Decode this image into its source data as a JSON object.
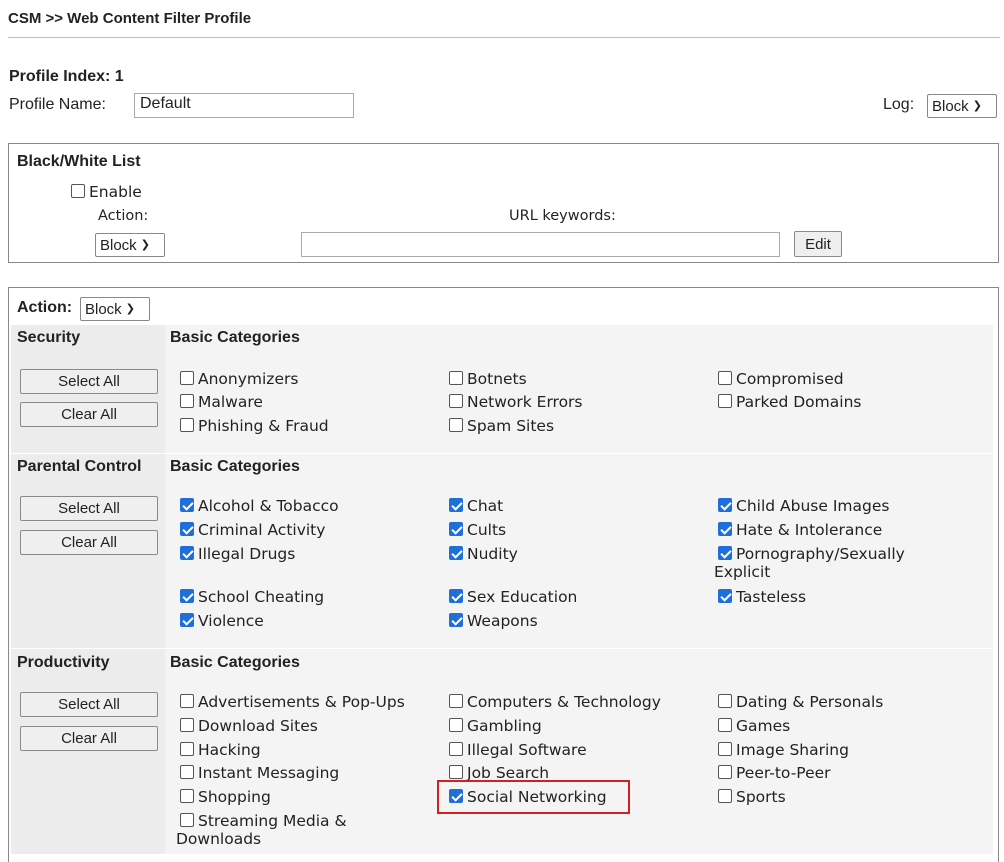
{
  "header": {
    "breadcrumb": "CSM >> Web Content Filter Profile"
  },
  "profile": {
    "index_label": "Profile Index: 1",
    "name_label": "Profile Name:",
    "name_value": "Default",
    "log_label": "Log:",
    "log_value": "Block"
  },
  "bw_list": {
    "title": "Black/White List",
    "enable_label": "Enable",
    "enable_checked": false,
    "action_label": "Action:",
    "action_value": "Block",
    "url_label": "URL keywords:",
    "url_value": "",
    "edit_label": "Edit"
  },
  "filter": {
    "action_label": "Action:",
    "action_value": "Block",
    "select_all_label": "Select All",
    "clear_all_label": "Clear All",
    "basic_categories_label": "Basic Categories",
    "groups": {
      "security": {
        "title": "Security",
        "items": [
          {
            "label": "Anonymizers",
            "checked": false
          },
          {
            "label": "Botnets",
            "checked": false
          },
          {
            "label": "Compromised",
            "checked": false
          },
          {
            "label": "Malware",
            "checked": false
          },
          {
            "label": "Network Errors",
            "checked": false
          },
          {
            "label": "Parked Domains",
            "checked": false
          },
          {
            "label": "Phishing & Fraud",
            "checked": false
          },
          {
            "label": "Spam Sites",
            "checked": false
          }
        ]
      },
      "parental": {
        "title": "Parental Control",
        "items": [
          {
            "label": "Alcohol & Tobacco",
            "checked": true
          },
          {
            "label": "Chat",
            "checked": true
          },
          {
            "label": "Child Abuse Images",
            "checked": true
          },
          {
            "label": "Criminal Activity",
            "checked": true
          },
          {
            "label": "Cults",
            "checked": true
          },
          {
            "label": "Hate & Intolerance",
            "checked": true
          },
          {
            "label": "Illegal Drugs",
            "checked": true
          },
          {
            "label": "Nudity",
            "checked": true
          },
          {
            "label": "Pornography/Sexually",
            "label2": "Explicit",
            "checked": true
          },
          {
            "label": "School Cheating",
            "checked": true
          },
          {
            "label": "Sex Education",
            "checked": true
          },
          {
            "label": "Tasteless",
            "checked": true
          },
          {
            "label": "Violence",
            "checked": true
          },
          {
            "label": "Weapons",
            "checked": true
          }
        ]
      },
      "productivity": {
        "title": "Productivity",
        "items": [
          {
            "label": "Advertisements & Pop-Ups",
            "checked": false
          },
          {
            "label": "Computers & Technology",
            "checked": false
          },
          {
            "label": "Dating & Personals",
            "checked": false
          },
          {
            "label": "Download Sites",
            "checked": false
          },
          {
            "label": "Gambling",
            "checked": false
          },
          {
            "label": "Games",
            "checked": false
          },
          {
            "label": "Hacking",
            "checked": false
          },
          {
            "label": "Illegal Software",
            "checked": false
          },
          {
            "label": "Image Sharing",
            "checked": false
          },
          {
            "label": "Instant Messaging",
            "checked": false
          },
          {
            "label": "Job Search",
            "checked": false
          },
          {
            "label": "Peer-to-Peer",
            "checked": false
          },
          {
            "label": "Shopping",
            "checked": false
          },
          {
            "label": "Social Networking",
            "checked": true
          },
          {
            "label": "Sports",
            "checked": false
          },
          {
            "label": "Streaming Media &",
            "label2": "Downloads",
            "checked": false
          }
        ]
      }
    }
  }
}
